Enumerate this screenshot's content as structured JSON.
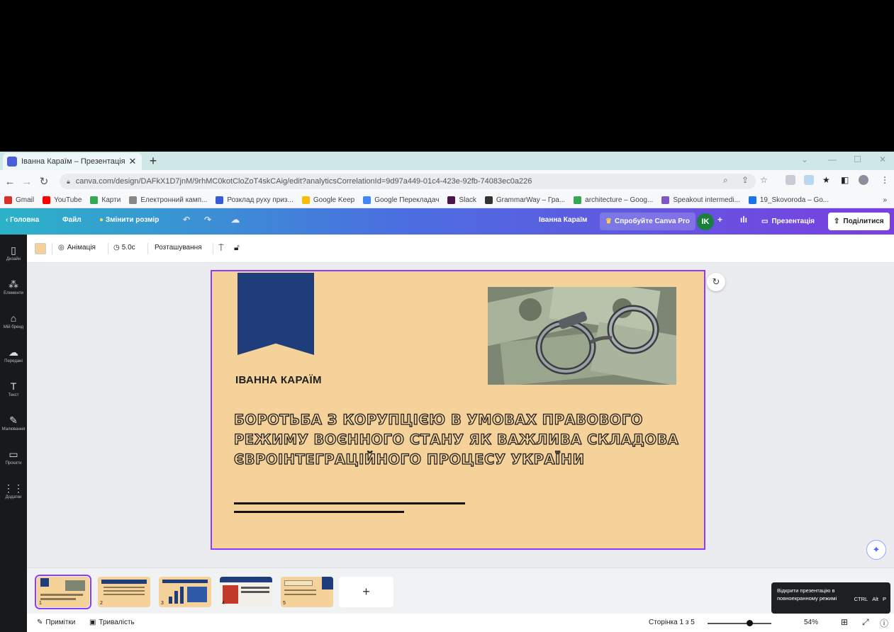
{
  "browser": {
    "tab_title": "Іванна Караїм – Презентація",
    "url": "canva.com/design/DAFkX1D7jnM/9rhMC0kotCloZoT4skCAig/edit?analyticsCorrelationId=9d97a449-01c4-423e-92fb-74083ec0a226",
    "bookmarks": [
      {
        "label": "Gmail",
        "color": "#d93025"
      },
      {
        "label": "YouTube",
        "color": "#ff0000"
      },
      {
        "label": "Карти",
        "color": "#34a853"
      },
      {
        "label": "Електронний камп...",
        "color": "#888888"
      },
      {
        "label": "Розклад руху приз...",
        "color": "#3a5bd8"
      },
      {
        "label": "Google Keep",
        "color": "#fbbc04"
      },
      {
        "label": "Google Перекладач",
        "color": "#4285f4"
      },
      {
        "label": "Slack",
        "color": "#4a154b"
      },
      {
        "label": "GrammarWay – Гра...",
        "color": "#333333"
      },
      {
        "label": "architecture – Goog...",
        "color": "#34a853"
      },
      {
        "label": "Speakout intermedi...",
        "color": "#7e57c2"
      },
      {
        "label": "19_Skovoroda – Go...",
        "color": "#1a73e8"
      }
    ],
    "more_bookmarks": "»"
  },
  "canva_header": {
    "home": "Головна",
    "file": "Файл",
    "resize": "Змінити розмір",
    "user_name": "Іванна Караїм",
    "try_pro": "Спробуйте Canva Pro",
    "avatar_initials": "IK",
    "present": "Презентація",
    "share": "Поділитися"
  },
  "sidebar": {
    "items": [
      {
        "label": "Дизайн",
        "icon": "▯"
      },
      {
        "label": "Елементи",
        "icon": "⁂"
      },
      {
        "label": "Мій бренд",
        "icon": "⌂"
      },
      {
        "label": "Передані",
        "icon": "☁"
      },
      {
        "label": "Текст",
        "icon": "T"
      },
      {
        "label": "Малювання",
        "icon": "✎"
      },
      {
        "label": "Проєкти",
        "icon": "▭"
      },
      {
        "label": "Додатки",
        "icon": "⋮⋮"
      }
    ]
  },
  "toolbar": {
    "animation": "Анімація",
    "duration": "5.0с",
    "position": "Розташування"
  },
  "slide": {
    "author": "ІВАННА КАРАЇМ",
    "title": "БОРОТЬБА З КОРУПЦІЄЮ В УМОВАХ ПРАВОВОГО РЕЖИМУ ВОЄННОГО СТАНУ ЯК ВАЖЛИВА СКЛАДОВА ЄВРОІНТЕГРАЦІЙНОГО ПРОЦЕСУ УКРАЇНИ",
    "photo_alt": "handcuffs on dollars"
  },
  "thumbnails": [
    "1",
    "2",
    "3",
    "4",
    "5"
  ],
  "bottombar": {
    "notes": "Примітки",
    "duration": "Тривалість",
    "page_indicator": "Сторінка 1 з 5",
    "zoom": "54%"
  },
  "tooltip": {
    "text": "Відкрити презентацію в повноекранному режимі",
    "keys": [
      "CTRL",
      "Alt",
      "P"
    ]
  },
  "colors": {
    "slide_bg": "#f5d29a",
    "ribbon": "#1f3d7a",
    "accent_purple": "#8b3dff"
  }
}
